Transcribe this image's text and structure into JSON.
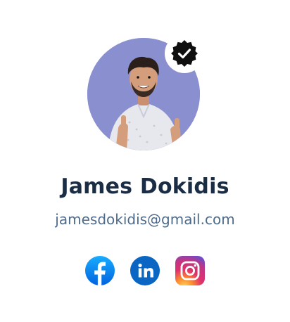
{
  "profile": {
    "name": "James Dokidis",
    "email": "jamesdokidis@gmail.com",
    "verified": true,
    "avatar_background": "#8a8fd0"
  },
  "social_links": [
    {
      "network": "Facebook",
      "icon": "facebook-icon",
      "color": "#1877f2"
    },
    {
      "network": "LinkedIn",
      "icon": "linkedin-icon",
      "color": "#0a66c2"
    },
    {
      "network": "Instagram",
      "icon": "instagram-icon",
      "color": "#e1306c"
    }
  ],
  "colors": {
    "name_text": "#1a2d45",
    "email_text": "#4f6b8c",
    "badge": "#0f0f0f"
  }
}
